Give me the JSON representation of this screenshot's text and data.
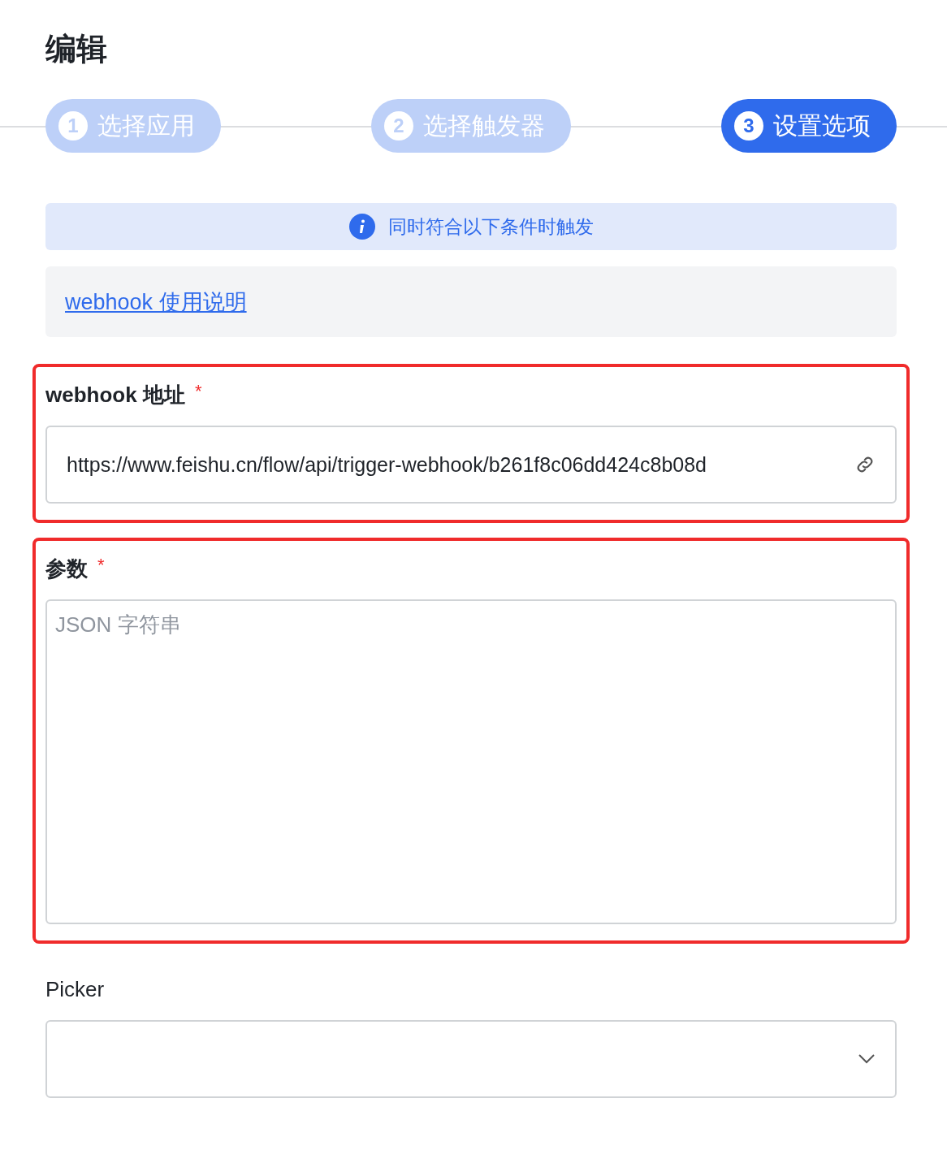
{
  "title": "编辑",
  "steps": [
    {
      "number": "1",
      "label": "选择应用",
      "selected": false
    },
    {
      "number": "2",
      "label": "选择触发器",
      "selected": false
    },
    {
      "number": "3",
      "label": "设置选项",
      "selected": true
    }
  ],
  "notice": {
    "text": "同时符合以下条件时触发"
  },
  "help_link": "webhook 使用说明",
  "fields": [
    {
      "kind": "input",
      "label": "webhook 地址",
      "required_mark": "*",
      "highlighted": true,
      "value": "https://www.feishu.cn/flow/api/trigger-webhook/b261f8c06dd424c8b08d"
    },
    {
      "kind": "textarea",
      "label": "参数",
      "required_mark": "*",
      "highlighted": true,
      "placeholder": "JSON 字符串"
    },
    {
      "kind": "select",
      "label": "Picker",
      "highlighted": false
    }
  ]
}
